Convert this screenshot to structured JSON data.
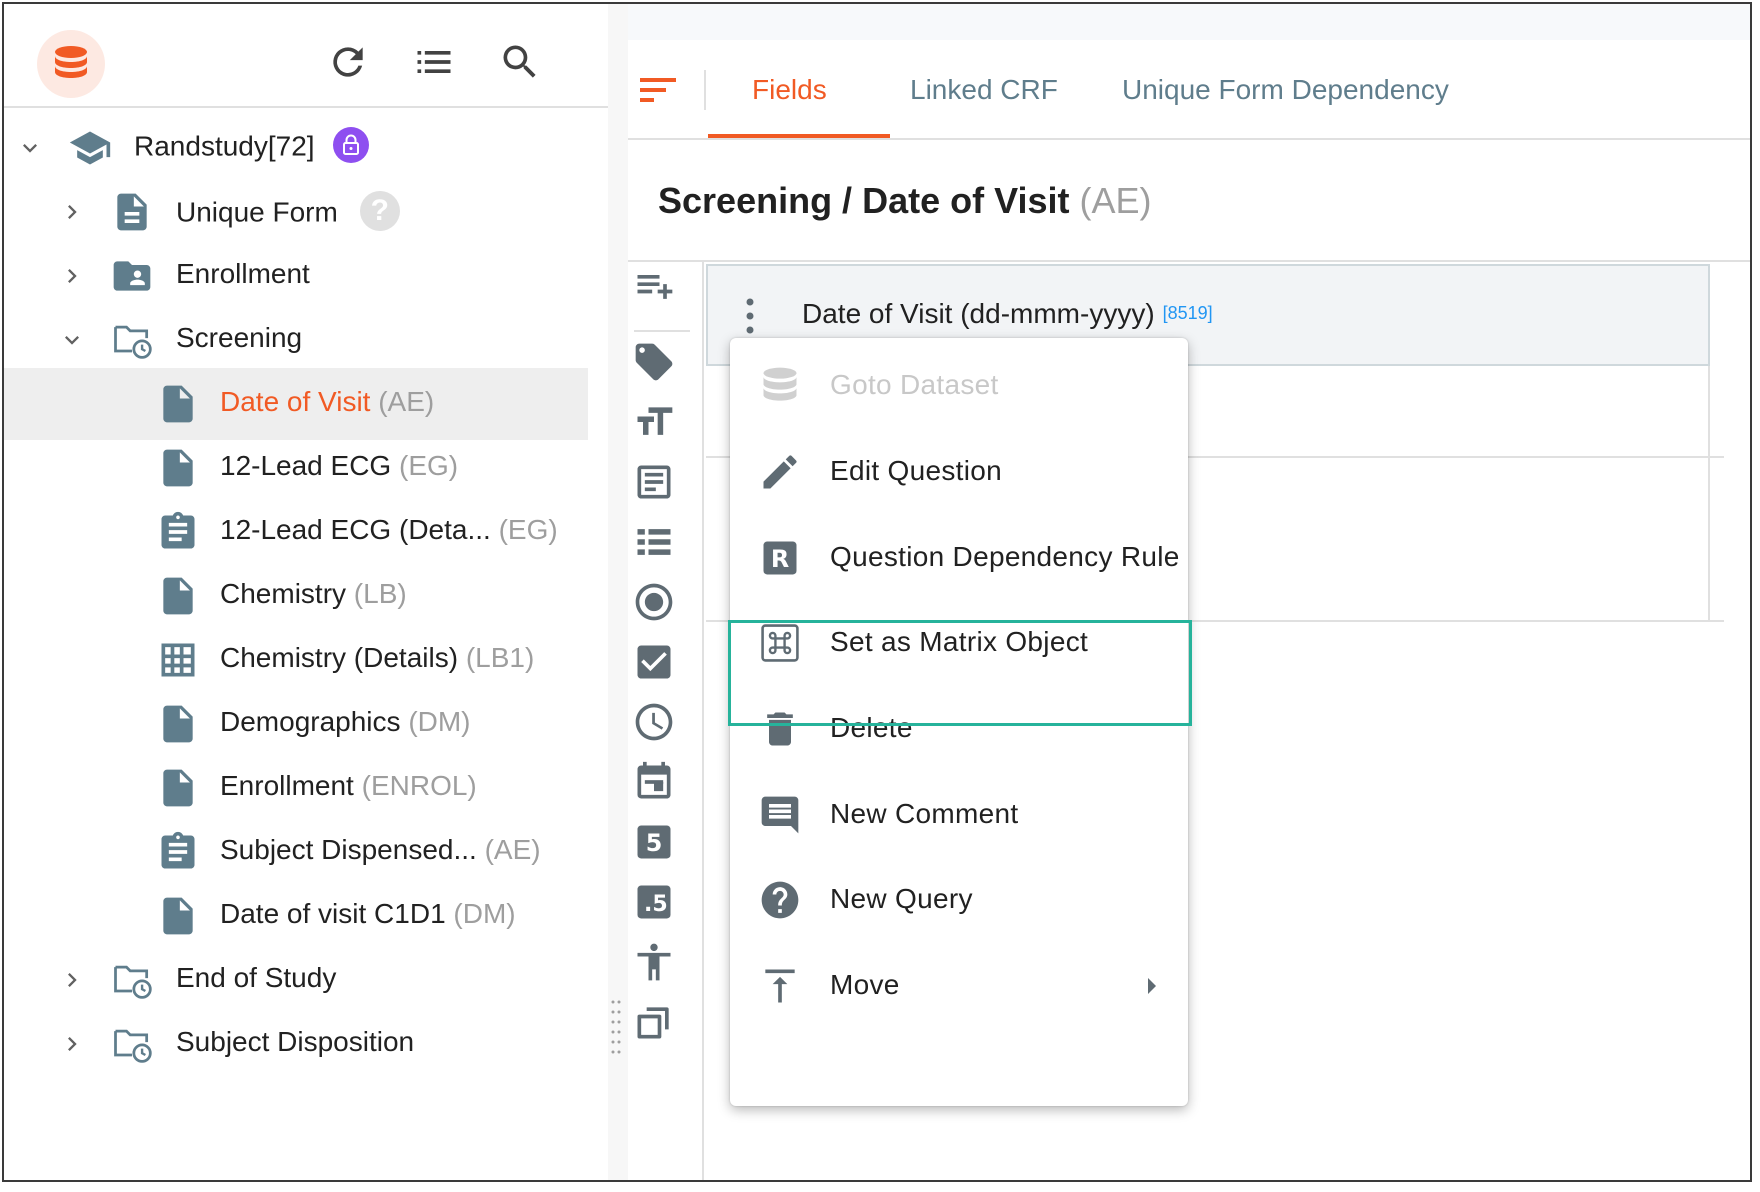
{
  "sidebar": {
    "study": {
      "label": "Randstudy[72]"
    },
    "items": [
      {
        "label": "Unique Form",
        "code": ""
      },
      {
        "label": "Enrollment",
        "code": ""
      },
      {
        "label": "Screening",
        "code": ""
      },
      {
        "label": "Date of Visit",
        "code": "(AE)"
      },
      {
        "label": "12-Lead ECG",
        "code": "(EG)"
      },
      {
        "label": "12-Lead ECG (Deta...",
        "code": "(EG)"
      },
      {
        "label": "Chemistry",
        "code": "(LB)"
      },
      {
        "label": "Chemistry (Details)",
        "code": "(LB1)"
      },
      {
        "label": "Demographics",
        "code": "(DM)"
      },
      {
        "label": "Enrollment",
        "code": "(ENROL)"
      },
      {
        "label": "Subject Dispensed...",
        "code": "(AE)"
      },
      {
        "label": "Date of visit C1D1",
        "code": "(DM)"
      },
      {
        "label": "End of Study",
        "code": ""
      },
      {
        "label": "Subject Disposition",
        "code": ""
      }
    ]
  },
  "tabs": [
    {
      "label": "Fields",
      "active": true
    },
    {
      "label": "Linked CRF",
      "active": false
    },
    {
      "label": "Unique Form Dependency",
      "active": false
    }
  ],
  "page": {
    "title": "Screening / Date of Visit",
    "title_code": "(AE)"
  },
  "field": {
    "label": "Date of Visit (dd-mmm-yyyy)",
    "id": "[8519]"
  },
  "context_menu": {
    "items": [
      {
        "label": "Goto Dataset",
        "icon": "database-icon",
        "enabled": false
      },
      {
        "label": "Edit Question",
        "icon": "pencil-icon",
        "enabled": true
      },
      {
        "label": "Question Dependency Rule",
        "icon": "rule-r-icon",
        "enabled": true
      },
      {
        "label": "Set as Matrix Object",
        "icon": "command-key-icon",
        "enabled": true,
        "highlighted": true
      },
      {
        "label": "Delete",
        "icon": "trash-icon",
        "enabled": true
      },
      {
        "label": "New Comment",
        "icon": "comment-icon",
        "enabled": true
      },
      {
        "label": "New Query",
        "icon": "help-circle-icon",
        "enabled": true
      },
      {
        "label": "Move",
        "icon": "move-up-icon",
        "enabled": true,
        "has_submenu": true
      }
    ]
  },
  "colors": {
    "accent": "#f15a24",
    "lock_badge": "#8e4ff0",
    "highlight_border": "#26b39b",
    "tab_inactive": "#5f7d8c",
    "icon_gray": "#5f6b73",
    "field_id": "#2196f3"
  }
}
